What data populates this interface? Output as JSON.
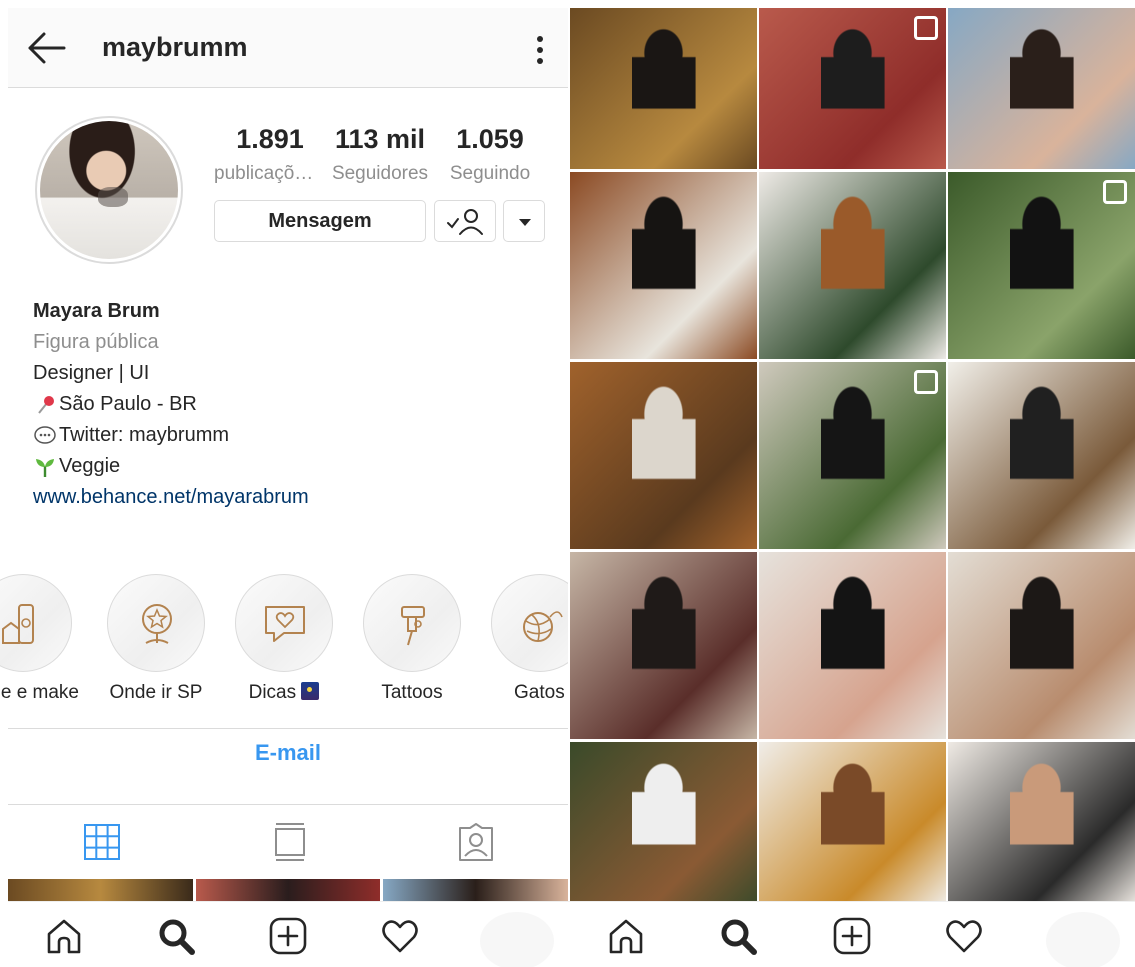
{
  "profile": {
    "username": "maybrumm",
    "stats": [
      {
        "value": "1.891",
        "label": "publicaçõ…"
      },
      {
        "value": "113 mil",
        "label": "Seguidores"
      },
      {
        "value": "1.059",
        "label": "Seguindo"
      }
    ],
    "message_button": "Mensagem",
    "name": "Mayara Brum",
    "category": "Figura pública",
    "bio_lines": [
      "Designer | UI",
      "São Paulo - BR",
      "Twitter: maybrumm",
      "Veggie"
    ],
    "website": "www.behance.net/mayarabrum",
    "highlights": [
      "e e make",
      "Onde ir SP",
      "Dicas",
      "Tattoos",
      "Gatos"
    ],
    "contact_button": "E-mail",
    "icons": {
      "back": "arrow-left-icon",
      "menu": "kebab-icon",
      "follow": "following-check-person-icon",
      "dropdown": "caret-down-icon",
      "grid_tab": "grid-icon",
      "feed_tab": "list-feed-icon",
      "tagged_tab": "tagged-person-icon"
    },
    "colors": {
      "link": "#003569",
      "accent": "#3897f0",
      "muted": "#8e8e8e"
    }
  },
  "navbar": {
    "items": [
      "home-icon",
      "search-icon",
      "add-post-icon",
      "activity-heart-icon",
      "profile-avatar"
    ]
  },
  "grid": {
    "photos": [
      {
        "desc": "mirror-selfie-black-outfit",
        "colors": [
          "#6b4a22",
          "#b7893f",
          "#1a1614"
        ]
      },
      {
        "desc": "street-black-jumpsuit",
        "colors": [
          "#b95a4c",
          "#8f2d2a",
          "#1d1d1d"
        ],
        "multi": true
      },
      {
        "desc": "glasses-denim-jacket",
        "colors": [
          "#86a8c4",
          "#d9b39b",
          "#2a1f1a"
        ]
      },
      {
        "desc": "mirror-selfie-bag",
        "colors": [
          "#8b4a23",
          "#e8e4dc",
          "#161412"
        ]
      },
      {
        "desc": "plant-leaves",
        "colors": [
          "#eeeae6",
          "#2e4a2c",
          "#9a5a2a"
        ]
      },
      {
        "desc": "garden-black-dress",
        "colors": [
          "#3b5a2a",
          "#8aa36a",
          "#121212"
        ],
        "multi": true
      },
      {
        "desc": "tattooed-hand-leopard",
        "colors": [
          "#a0622c",
          "#5a3a1e",
          "#dcd6cc"
        ]
      },
      {
        "desc": "patio-jacket",
        "colors": [
          "#cfc9bd",
          "#4a6a34",
          "#151515"
        ],
        "multi": true
      },
      {
        "desc": "mirror-leopard-skirt",
        "colors": [
          "#f1efe9",
          "#7a5a3a",
          "#202020"
        ]
      },
      {
        "desc": "crowd-event",
        "colors": [
          "#c6b6a6",
          "#5a2e2a",
          "#1f1a18"
        ]
      },
      {
        "desc": "selfie-adidas-jacket",
        "colors": [
          "#e6e2dc",
          "#d6a38e",
          "#141414"
        ]
      },
      {
        "desc": "portrait-bralette",
        "colors": [
          "#e3ddd4",
          "#b88c6e",
          "#1c1816"
        ]
      },
      {
        "desc": "sitting-bench",
        "colors": [
          "#3a4a2a",
          "#8a5a34",
          "#eeeeee"
        ]
      },
      {
        "desc": "yellow-jumpsuit",
        "colors": [
          "#f0ede8",
          "#c98a2a",
          "#7a4a28"
        ]
      },
      {
        "desc": "neck-tattoo-shirt",
        "colors": [
          "#efeae4",
          "#2a2a2a",
          "#c99a7a"
        ]
      }
    ]
  }
}
